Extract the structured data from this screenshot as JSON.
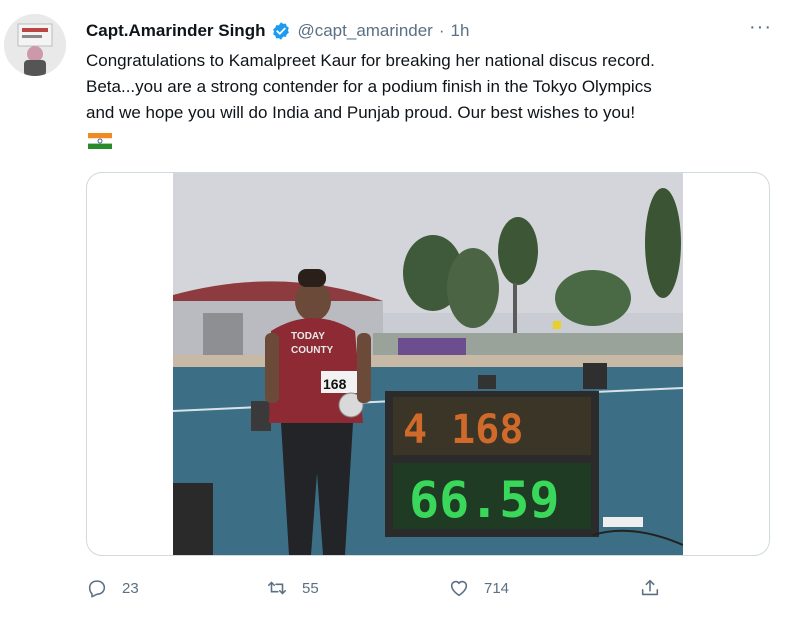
{
  "tweet": {
    "author_name": "Capt.Amarinder Singh",
    "handle": "@capt_amarinder",
    "separator": "·",
    "time": "1h",
    "more": "···",
    "text_lines": [
      "Congratulations to Kamalpreet Kaur for breaking her national discus record.",
      "Beta...you are a strong contender for a podium finish in the Tokyo Olympics",
      "and we hope you will do India and Punjab proud. Our best wishes to you!"
    ],
    "emoji": "india-flag-emoji",
    "image": {
      "bib_number": "168",
      "scoreboard_top": "4 168",
      "scoreboard_bottom": "66.59",
      "shirt_text_1": "TODAY",
      "shirt_text_2": "COUNTY"
    },
    "actions": {
      "reply_count": "23",
      "retweet_count": "55",
      "like_count": "714"
    }
  },
  "colors": {
    "verified": "#1d9bf0",
    "muted": "#5b7083",
    "border": "#cfd9de"
  }
}
